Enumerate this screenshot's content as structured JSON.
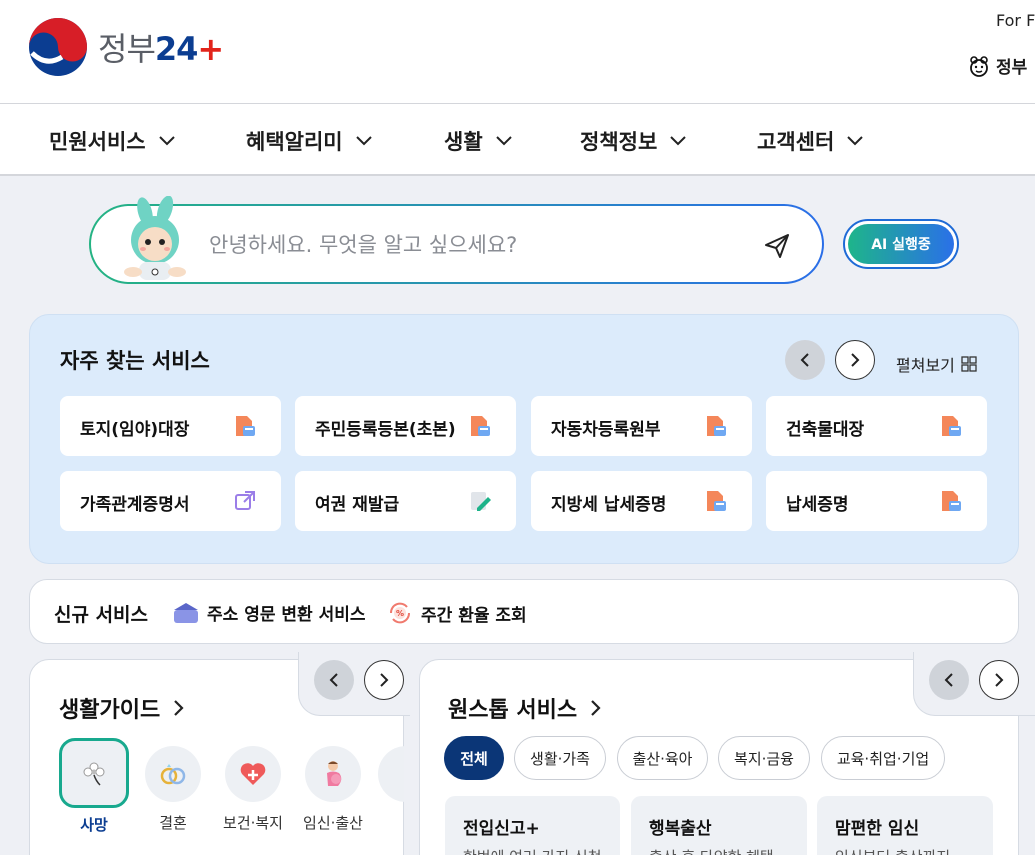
{
  "header": {
    "logo_text": "정부",
    "logo_num": "24",
    "logo_plus": "+",
    "lang_link": "For F",
    "gov_link": "정부"
  },
  "gnb": [
    {
      "label": "민원서비스"
    },
    {
      "label": "혜택알리미"
    },
    {
      "label": "생활"
    },
    {
      "label": "정책정보"
    },
    {
      "label": "고객센터"
    }
  ],
  "search": {
    "placeholder": "안녕하세요. 무엇을 알고 싶으세요?",
    "ai_button": "AI 실행중"
  },
  "frequent": {
    "title": "자주 찾는 서비스",
    "expand_label": "펼쳐보기",
    "items": [
      {
        "label": "토지(임야)대장",
        "icon": "pdf-doc-icon"
      },
      {
        "label": "주민등록등본(초본)",
        "icon": "pdf-doc-icon"
      },
      {
        "label": "자동차등록원부",
        "icon": "pdf-doc-icon"
      },
      {
        "label": "건축물대장",
        "icon": "pdf-doc-icon"
      },
      {
        "label": "가족관계증명서",
        "icon": "external-link-icon"
      },
      {
        "label": "여권 재발급",
        "icon": "edit-icon"
      },
      {
        "label": "지방세 납세증명",
        "icon": "pdf-doc-icon"
      },
      {
        "label": "납세증명",
        "icon": "pdf-doc-icon"
      }
    ]
  },
  "new_services": {
    "title": "신규 서비스",
    "items": [
      {
        "label": "주소 영문 변환 서비스",
        "icon": "address-card-icon"
      },
      {
        "label": "주간 환율 조회",
        "icon": "exchange-rate-icon"
      }
    ]
  },
  "life_guide": {
    "title": "생활가이드",
    "items": [
      {
        "label": "사망",
        "active": true
      },
      {
        "label": "결혼"
      },
      {
        "label": "보건·복지"
      },
      {
        "label": "임신·출산"
      }
    ]
  },
  "onestop": {
    "title": "원스톱 서비스",
    "chips": [
      "전체",
      "생활·가족",
      "출산·육아",
      "복지·금융",
      "교육·취업·기업"
    ],
    "cards": [
      {
        "title": "전입신고+",
        "desc": "한번에 여러 가지 신청"
      },
      {
        "title": "행복출산",
        "desc": "출산 후 다양한 혜택"
      },
      {
        "title": "맘편한 임신",
        "desc": "임신부터 출산까지"
      }
    ]
  },
  "colors": {
    "brand_navy": "#0b3677",
    "accent_green": "#18a98e",
    "freq_bg": "#dcebfb"
  }
}
